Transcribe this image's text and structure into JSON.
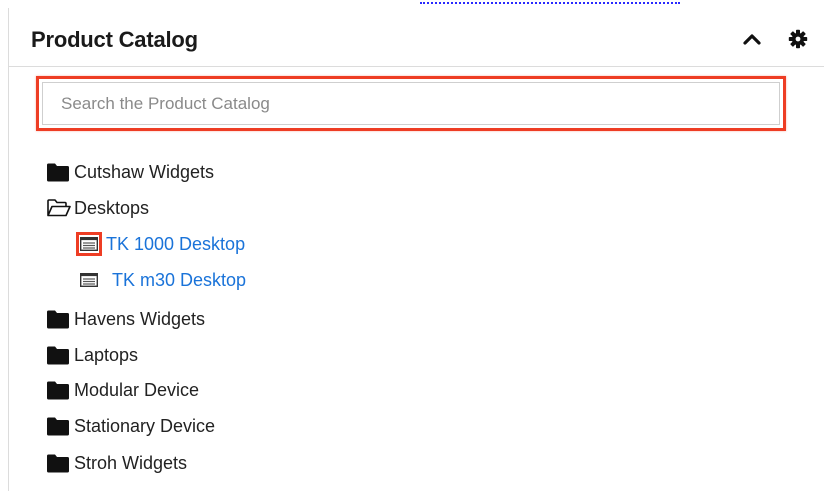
{
  "dashlet": {
    "title": "Product Catalog",
    "collapse_icon": "chevron-up-icon",
    "settings_icon": "gear-icon"
  },
  "search": {
    "placeholder": "Search the Product Catalog",
    "value": ""
  },
  "tree": [
    {
      "label": "Cutshaw Widgets",
      "type": "folder",
      "expanded": false
    },
    {
      "label": "Desktops",
      "type": "folder",
      "expanded": true,
      "children": [
        {
          "label": "TK 1000 Desktop",
          "type": "product"
        },
        {
          "label": "TK m30 Desktop",
          "type": "product"
        }
      ]
    },
    {
      "label": "Havens Widgets",
      "type": "folder",
      "expanded": false
    },
    {
      "label": "Laptops",
      "type": "folder",
      "expanded": false
    },
    {
      "label": "Modular Device",
      "type": "folder",
      "expanded": false
    },
    {
      "label": "Stationary Device",
      "type": "folder",
      "expanded": false
    },
    {
      "label": "Stroh Widgets",
      "type": "folder",
      "expanded": false
    }
  ],
  "colors": {
    "highlight": "#ee3d24",
    "link": "#1a73d9"
  }
}
